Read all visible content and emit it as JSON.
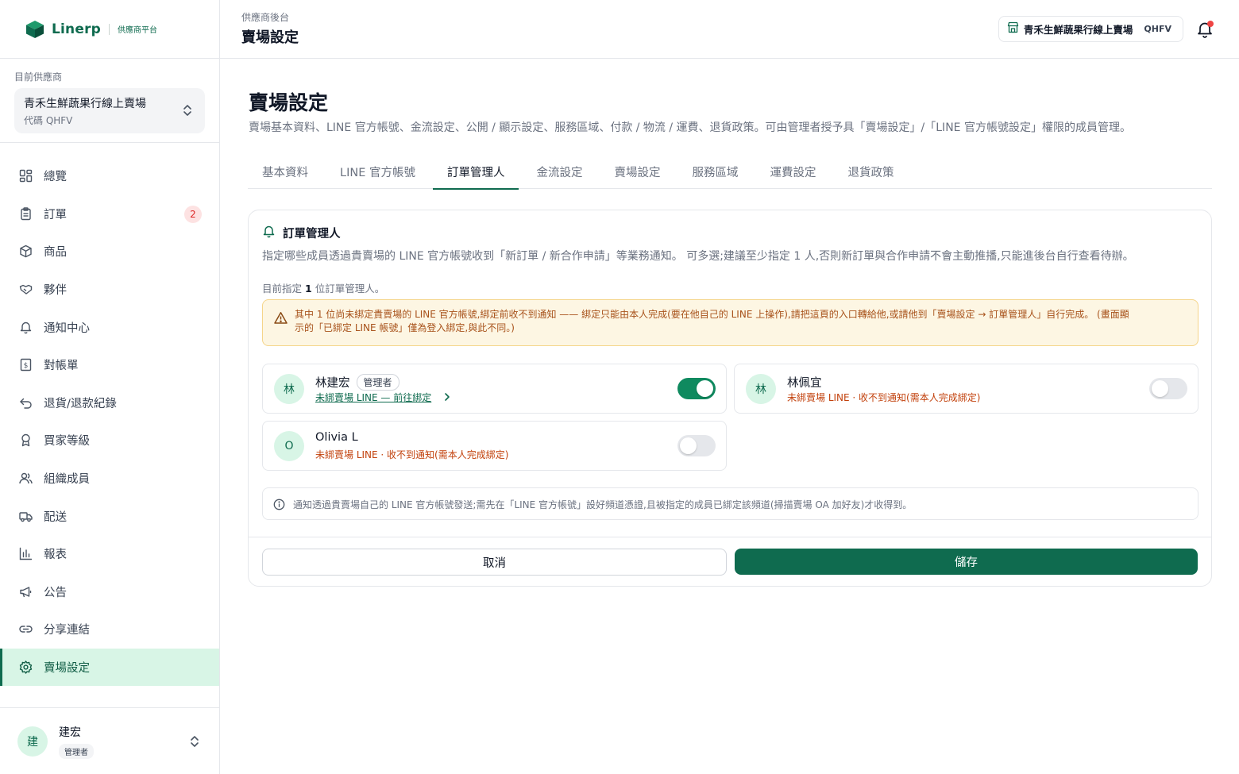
{
  "brand": {
    "name": "Linerp",
    "tagline": "供應商平台"
  },
  "supplier": {
    "caption": "目前供應商",
    "name": "青禾生鮮蔬果行線上賣場",
    "code": "代碼 QHFV"
  },
  "nav": {
    "items": [
      {
        "label": "總覽",
        "icon": "dashboard-icon"
      },
      {
        "label": "訂單",
        "icon": "clipboard-icon",
        "badge": "2"
      },
      {
        "label": "商品",
        "icon": "box-icon"
      },
      {
        "label": "夥伴",
        "icon": "handshake-icon"
      },
      {
        "label": "通知中心",
        "icon": "bell-icon"
      },
      {
        "label": "對帳單",
        "icon": "receipt-icon"
      },
      {
        "label": "退貨/退款紀錄",
        "icon": "return-icon"
      },
      {
        "label": "買家等級",
        "icon": "award-icon"
      },
      {
        "label": "組織成員",
        "icon": "users-icon"
      },
      {
        "label": "配送",
        "icon": "truck-icon"
      },
      {
        "label": "報表",
        "icon": "bar-chart-icon"
      },
      {
        "label": "公告",
        "icon": "megaphone-icon"
      },
      {
        "label": "分享連結",
        "icon": "link-icon"
      },
      {
        "label": "賣場設定",
        "icon": "gear-icon",
        "active": true
      }
    ]
  },
  "user": {
    "avatar": "建",
    "name": "建宏",
    "role": "管理者"
  },
  "topbar": {
    "breadcrumb": "供應商後台",
    "title": "賣場設定",
    "store_name": "青禾生鮮蔬果行線上賣場",
    "store_code": "QHFV"
  },
  "page": {
    "title": "賣場設定",
    "description": "賣場基本資料、LINE 官方帳號、金流設定、公開 / 顯示設定、服務區域、付款 / 物流 / 運費、退貨政策。可由管理者授予具「賣場設定」/「LINE 官方帳號設定」權限的成員管理。"
  },
  "tabs": [
    {
      "label": "基本資料"
    },
    {
      "label": "LINE 官方帳號"
    },
    {
      "label": "訂單管理人",
      "active": true
    },
    {
      "label": "金流設定"
    },
    {
      "label": "賣場設定"
    },
    {
      "label": "服務區域"
    },
    {
      "label": "運費設定"
    },
    {
      "label": "退貨政策"
    }
  ],
  "section": {
    "title": "訂單管理人",
    "description": "指定哪些成員透過貴賣場的 LINE 官方帳號收到「新訂單 / 新合作申請」等業務通知。 可多選;建議至少指定 1 人,否則新訂單與合作申請不會主動推播,只能進後台自行查看待辦。",
    "count_prefix": "目前指定",
    "count_value": "1",
    "count_suffix": "位訂單管理人。",
    "warning_line1": "其中 1 位尚未綁定貴賣場的 LINE 官方帳號,綁定前收不到通知 —— 綁定只能由本人完成(要在他自己的 LINE 上操作),請把這頁的入口轉給他,或請他到「賣場設定 → 訂單管理人」自行完成。 (畫面顯",
    "warning_line2": "示的「已綁定 LINE 帳號」僅為登入綁定,與此不同。)",
    "info": "通知透過貴賣場自己的 LINE 官方帳號發送;需先在「LINE 官方帳號」設好頻道憑證,且被指定的成員已綁定該頻道(掃描賣場 OA 加好友)才收得到。"
  },
  "members": [
    {
      "avatar": "林",
      "name": "林建宏",
      "role": "管理者",
      "link": "未綁賣場 LINE — 前往綁定",
      "enabled": true
    },
    {
      "avatar": "林",
      "name": "林佩宜",
      "status": "未綁賣場 LINE · 收不到通知(需本人完成綁定)",
      "enabled": false
    },
    {
      "avatar": "O",
      "name": "Olivia L",
      "status": "未綁賣場 LINE · 收不到通知(需本人完成綁定)",
      "enabled": false
    }
  ],
  "actions": {
    "cancel": "取消",
    "save": "儲存"
  },
  "colors": {
    "brand": "#0f6b4f",
    "active_bg": "#d8f5e6",
    "warning_text": "#c2410c",
    "warning_bg": "#fdf6e3"
  }
}
